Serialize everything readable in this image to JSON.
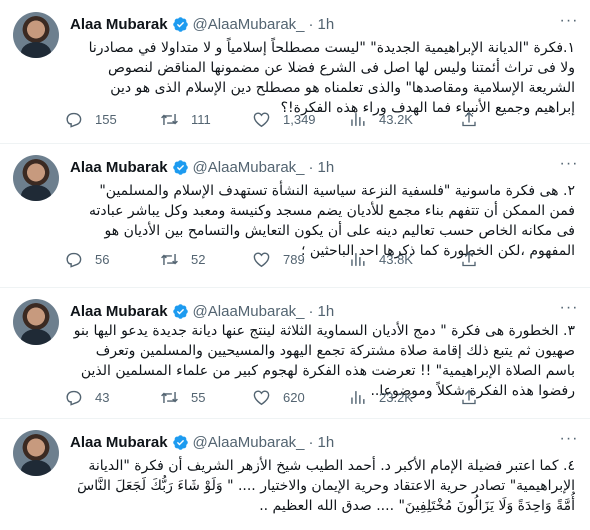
{
  "tweets": [
    {
      "name": "Alaa Mubarak",
      "handle": "@AlaaMubarak_",
      "time": "1h",
      "text": "١.فكرة \"الديانة الإبراهيمية الجديدة\" \"ليست مصطلحاً إسلامياً و لا متداولا في مصادرنا ولا فى تراث أئمتنا وليس لها اصل فى الشرع فضلا عن مضمونها المناقض لنصوص الشريعة الإسلامية ومقاصدها\" والذى تعلمناه هو مصطلح دين الإسلام الذى هو دين إبراهيم وجميع الأنبياء فما الهدف وراء هذه الفكرة!؟",
      "replies": "155",
      "retweets": "111",
      "likes": "1,349",
      "views": "43.2K"
    },
    {
      "name": "Alaa Mubarak",
      "handle": "@AlaaMubarak_",
      "time": "1h",
      "text": "٢. هى فكرة ماسونية \"فلسفية النزعة سياسية النشأة تستهدف الإسلام والمسلمين\" فمن الممكن أن تتفهم بناء مجمع للأديان يضم مسجد وكنيسة ومعبد وكل يباشر عبادته فى مكانه الخاص حسب تعاليم دينه على أن يكون التعايش والتسامح بين الأديان هو المفهوم ،لكن الخطورة كما ذكرها احد الباحثين ؛",
      "replies": "56",
      "retweets": "52",
      "likes": "789",
      "views": "43.8K"
    },
    {
      "name": "Alaa Mubarak",
      "handle": "@AlaaMubarak_",
      "time": "1h",
      "text": "٣. الخطورة هى فكرة \" دمج الأديان السماوية الثلاثة لينتج عنها ديانة جديدة يدعو اليها بنو صهيون ثم يتبع ذلك إقامة صلاة مشتركة تجمع اليهود والمسيحيين والمسلمين وتعرف باسم الصلاة الإبراهيمية\" !! تعرضت هذه الفكرة لهجوم كبير من علماء المسلمين الذين رفضوا هذه الفكرة شكلاً وموضوعا..",
      "replies": "43",
      "retweets": "55",
      "likes": "620",
      "views": "23.2K"
    },
    {
      "name": "Alaa Mubarak",
      "handle": "@AlaaMubarak_",
      "time": "1h",
      "text": "٤. كما اعتبر فضيلة الإمام الأكبر د. أحمد الطيب شيخ الأزهر الشريف أن فكرة \"الديانة الإبراهيمية\" تصادر حرية الاعتقاد وحرية الإيمان والاختيار .... \" وَلَوْ شَاءَ رَبُّكَ لَجَعَلَ النَّاسَ أُمَّةً وَاحِدَةً وَلَا يَزَالُونَ مُخْتَلِفِينَ\" .... صدق الله العظيم .."
    }
  ],
  "more_glyph": "···"
}
